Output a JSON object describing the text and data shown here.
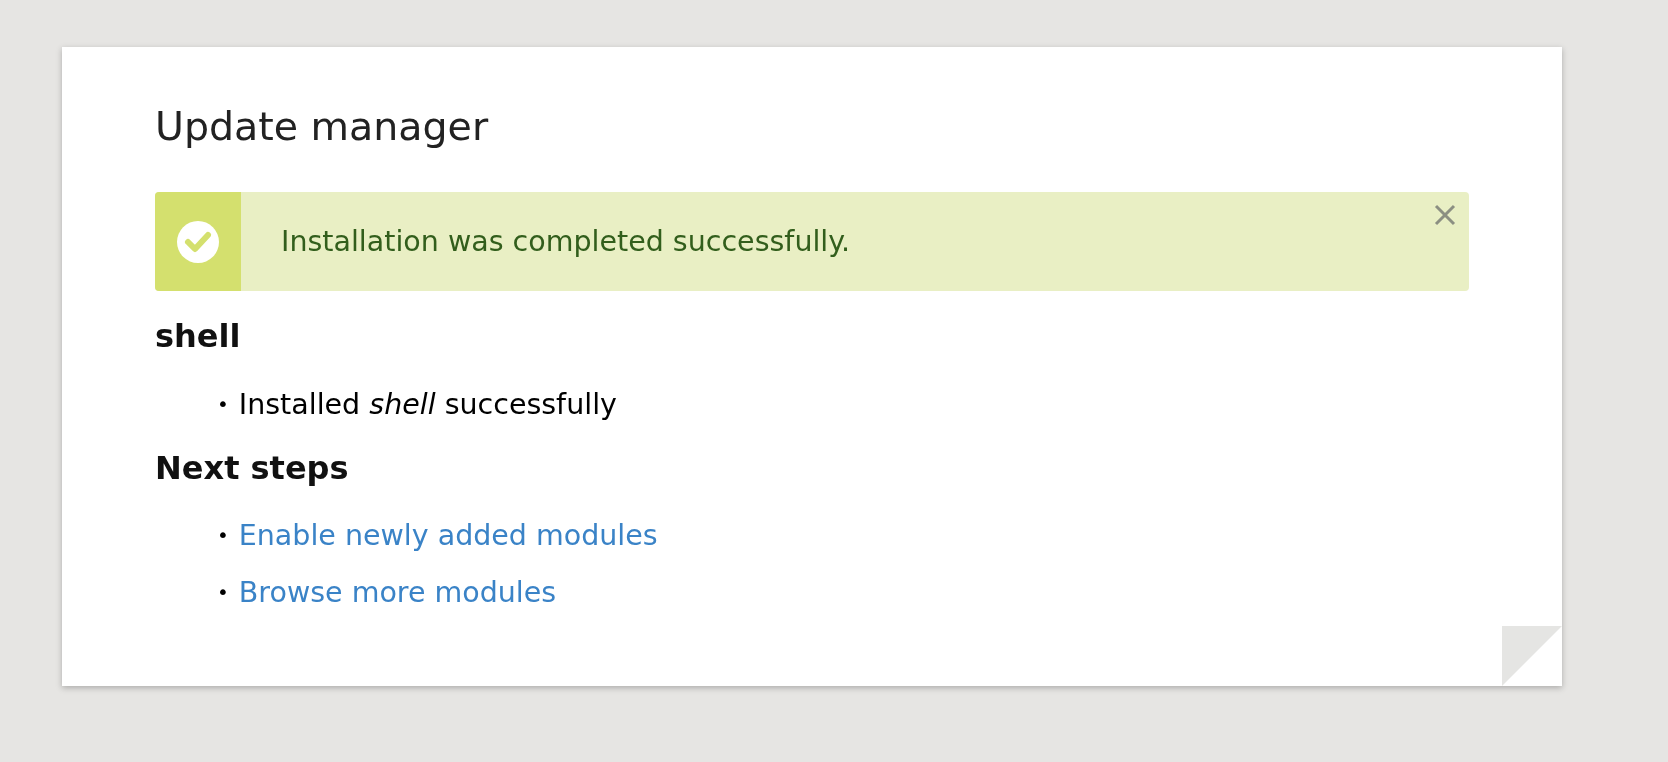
{
  "page": {
    "title": "Update manager"
  },
  "message": {
    "kind": "status",
    "text": "Installation was completed successfully."
  },
  "sections": [
    {
      "heading": "shell",
      "items": [
        {
          "kind": "text",
          "marker": "•",
          "text": "Installed *shell* successfully"
        }
      ]
    },
    {
      "heading": "Next steps",
      "items": [
        {
          "kind": "link",
          "marker": "•",
          "text": "Enable newly added modules"
        },
        {
          "kind": "link",
          "marker": "•",
          "text": "Browse more modules"
        }
      ]
    }
  ]
}
